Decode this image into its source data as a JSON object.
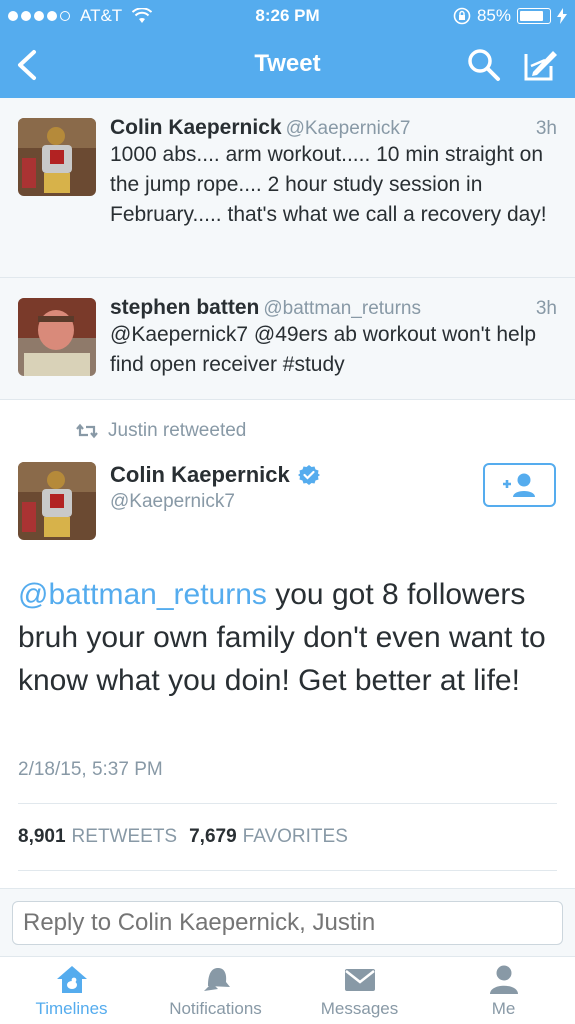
{
  "status_bar": {
    "carrier": "AT&T",
    "time": "8:26 PM",
    "battery": "85%",
    "battery_level": 0.85
  },
  "nav": {
    "title": "Tweet"
  },
  "replies": [
    {
      "name": "Colin Kaepernick",
      "handle": "@Kaepernick7",
      "time": "3h",
      "text": "1000 abs.... arm workout..... 10 min straight on the jump rope.... 2 hour study session in February..... that's what we call a recovery day!"
    },
    {
      "name": "stephen batten",
      "handle": "@battman_returns",
      "time": "3h",
      "text": "@Kaepernick7 @49ers ab workout won't help find open receiver #study"
    }
  ],
  "main_tweet": {
    "retweeted_by": "Justin retweeted",
    "name": "Colin Kaepernick",
    "handle": "@Kaepernick7",
    "mention": "@battman_returns",
    "text": " you got 8 followers bruh your own family don't even want to know what you doin! Get better at life!",
    "timestamp": "2/18/15, 5:37 PM",
    "retweets_count": "8,901",
    "retweets_label": "RETWEETS",
    "favorites_count": "7,679",
    "favorites_label": "FAVORITES"
  },
  "reply_bar": {
    "placeholder": "Reply to Colin Kaepernick, Justin"
  },
  "tabs": [
    {
      "label": "Timelines",
      "icon": "home-icon",
      "active": true
    },
    {
      "label": "Notifications",
      "icon": "bell-icon",
      "active": false
    },
    {
      "label": "Messages",
      "icon": "envelope-icon",
      "active": false
    },
    {
      "label": "Me",
      "icon": "person-icon",
      "active": false
    }
  ],
  "colors": {
    "brand": "#55acee",
    "text": "#292f33",
    "muted": "#8899a6"
  }
}
